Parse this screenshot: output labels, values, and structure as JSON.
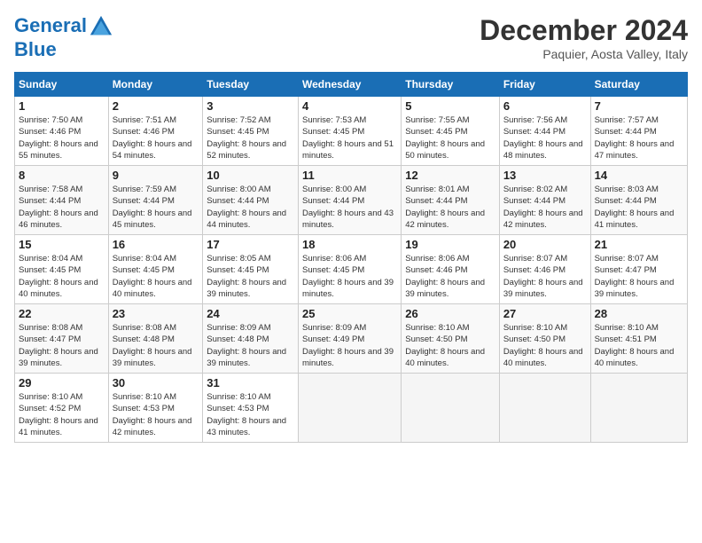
{
  "header": {
    "logo_line1": "General",
    "logo_line2": "Blue",
    "month_title": "December 2024",
    "location": "Paquier, Aosta Valley, Italy"
  },
  "days_of_week": [
    "Sunday",
    "Monday",
    "Tuesday",
    "Wednesday",
    "Thursday",
    "Friday",
    "Saturday"
  ],
  "weeks": [
    [
      {
        "num": "1",
        "rise": "7:50 AM",
        "set": "4:46 PM",
        "daylight": "8 hours and 55 minutes."
      },
      {
        "num": "2",
        "rise": "7:51 AM",
        "set": "4:46 PM",
        "daylight": "8 hours and 54 minutes."
      },
      {
        "num": "3",
        "rise": "7:52 AM",
        "set": "4:45 PM",
        "daylight": "8 hours and 52 minutes."
      },
      {
        "num": "4",
        "rise": "7:53 AM",
        "set": "4:45 PM",
        "daylight": "8 hours and 51 minutes."
      },
      {
        "num": "5",
        "rise": "7:55 AM",
        "set": "4:45 PM",
        "daylight": "8 hours and 50 minutes."
      },
      {
        "num": "6",
        "rise": "7:56 AM",
        "set": "4:44 PM",
        "daylight": "8 hours and 48 minutes."
      },
      {
        "num": "7",
        "rise": "7:57 AM",
        "set": "4:44 PM",
        "daylight": "8 hours and 47 minutes."
      }
    ],
    [
      {
        "num": "8",
        "rise": "7:58 AM",
        "set": "4:44 PM",
        "daylight": "8 hours and 46 minutes."
      },
      {
        "num": "9",
        "rise": "7:59 AM",
        "set": "4:44 PM",
        "daylight": "8 hours and 45 minutes."
      },
      {
        "num": "10",
        "rise": "8:00 AM",
        "set": "4:44 PM",
        "daylight": "8 hours and 44 minutes."
      },
      {
        "num": "11",
        "rise": "8:00 AM",
        "set": "4:44 PM",
        "daylight": "8 hours and 43 minutes."
      },
      {
        "num": "12",
        "rise": "8:01 AM",
        "set": "4:44 PM",
        "daylight": "8 hours and 42 minutes."
      },
      {
        "num": "13",
        "rise": "8:02 AM",
        "set": "4:44 PM",
        "daylight": "8 hours and 42 minutes."
      },
      {
        "num": "14",
        "rise": "8:03 AM",
        "set": "4:44 PM",
        "daylight": "8 hours and 41 minutes."
      }
    ],
    [
      {
        "num": "15",
        "rise": "8:04 AM",
        "set": "4:45 PM",
        "daylight": "8 hours and 40 minutes."
      },
      {
        "num": "16",
        "rise": "8:04 AM",
        "set": "4:45 PM",
        "daylight": "8 hours and 40 minutes."
      },
      {
        "num": "17",
        "rise": "8:05 AM",
        "set": "4:45 PM",
        "daylight": "8 hours and 39 minutes."
      },
      {
        "num": "18",
        "rise": "8:06 AM",
        "set": "4:45 PM",
        "daylight": "8 hours and 39 minutes."
      },
      {
        "num": "19",
        "rise": "8:06 AM",
        "set": "4:46 PM",
        "daylight": "8 hours and 39 minutes."
      },
      {
        "num": "20",
        "rise": "8:07 AM",
        "set": "4:46 PM",
        "daylight": "8 hours and 39 minutes."
      },
      {
        "num": "21",
        "rise": "8:07 AM",
        "set": "4:47 PM",
        "daylight": "8 hours and 39 minutes."
      }
    ],
    [
      {
        "num": "22",
        "rise": "8:08 AM",
        "set": "4:47 PM",
        "daylight": "8 hours and 39 minutes."
      },
      {
        "num": "23",
        "rise": "8:08 AM",
        "set": "4:48 PM",
        "daylight": "8 hours and 39 minutes."
      },
      {
        "num": "24",
        "rise": "8:09 AM",
        "set": "4:48 PM",
        "daylight": "8 hours and 39 minutes."
      },
      {
        "num": "25",
        "rise": "8:09 AM",
        "set": "4:49 PM",
        "daylight": "8 hours and 39 minutes."
      },
      {
        "num": "26",
        "rise": "8:10 AM",
        "set": "4:50 PM",
        "daylight": "8 hours and 40 minutes."
      },
      {
        "num": "27",
        "rise": "8:10 AM",
        "set": "4:50 PM",
        "daylight": "8 hours and 40 minutes."
      },
      {
        "num": "28",
        "rise": "8:10 AM",
        "set": "4:51 PM",
        "daylight": "8 hours and 40 minutes."
      }
    ],
    [
      {
        "num": "29",
        "rise": "8:10 AM",
        "set": "4:52 PM",
        "daylight": "8 hours and 41 minutes."
      },
      {
        "num": "30",
        "rise": "8:10 AM",
        "set": "4:53 PM",
        "daylight": "8 hours and 42 minutes."
      },
      {
        "num": "31",
        "rise": "8:10 AM",
        "set": "4:53 PM",
        "daylight": "8 hours and 43 minutes."
      },
      null,
      null,
      null,
      null
    ]
  ]
}
